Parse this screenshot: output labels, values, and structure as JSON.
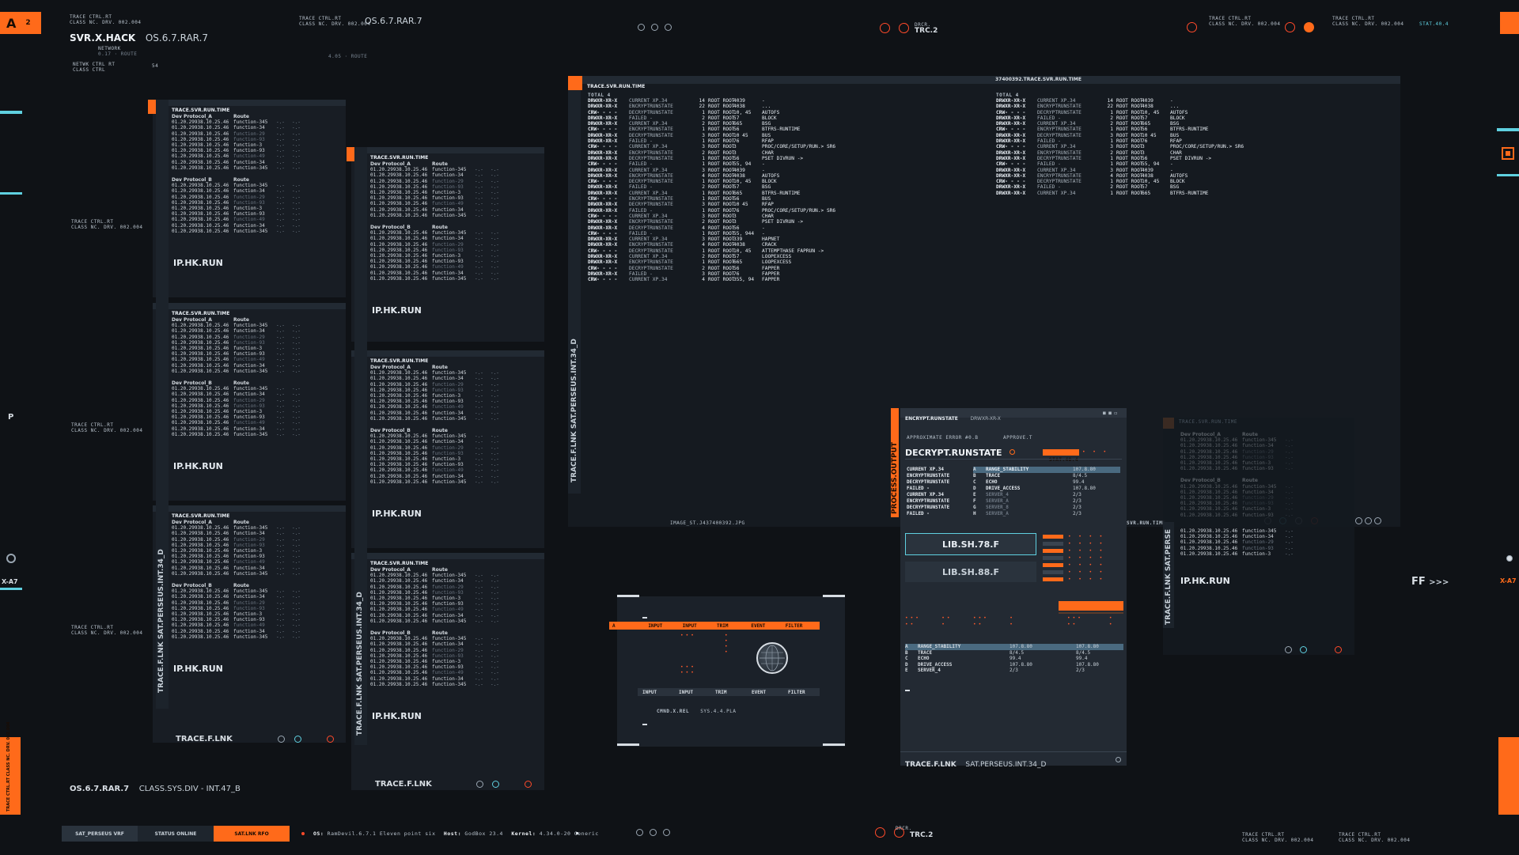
{
  "header": {
    "logo_letter": "A",
    "logo_num": "2",
    "app_small_1": "TRACE CTRL.RT",
    "app_small_2": "CLASS NC. DRV. 002.004",
    "title_bold": "SVR.X.HACK",
    "title_version": "OS.6.7.RAR.7",
    "network_label": "NETWORK",
    "network_sub": "0.17 · ROUTE",
    "netctrl_1": "NETWK CTRL RT",
    "netctrl_2": "CLASS CTRL",
    "netctrl_val": "54",
    "mid_small_1": "TRACE CTRL.RT",
    "mid_small_2": "CLASS NC. DRV. 002.004",
    "mid_version": "OS.6.7.RAR.7",
    "mid_route": "4.05 · ROUTE",
    "trc_small": "DRCR.",
    "trc_label": "TRC.2",
    "right_small_1": "TRACE CTRL.RT",
    "right_small_2": "CLASS NC. DRV. 002.004",
    "right_small_3": "TRACE CTRL.RT",
    "right_small_4": "CLASS NC. DRV. 002.004",
    "right_tag": "STAT.40.4"
  },
  "left_side": {
    "label_a": "TRACE CTRL.RT",
    "label_b": "CLASS NC. DRV. 002.004",
    "p_label": "P",
    "xa7": "X-A7",
    "bottom_vertical": "TRACE CTRL.RT CLASS NC. DRV. 002.004"
  },
  "route_panel": {
    "header": "TRACE.SVR.RUN.TIME",
    "col_a": "Dev Protocol_A",
    "col_b": "Dev Protocol_B",
    "col_route": "Route",
    "rows": [
      {
        "t": "01.20.29938.10.25.46",
        "f": "function-345",
        "dim": false
      },
      {
        "t": "01.20.29938.10.25.46",
        "f": "function-34",
        "dim": false
      },
      {
        "t": "01.20.29938.10.25.46",
        "f": "function-29",
        "dim": true
      },
      {
        "t": "01.20.29938.10.25.46",
        "f": "function-93",
        "dim": true
      },
      {
        "t": "01.20.29938.10.25.46",
        "f": "function-3",
        "dim": false
      },
      {
        "t": "01.20.29938.10.25.46",
        "f": "function-93",
        "dim": false
      },
      {
        "t": "01.20.29938.10.25.46",
        "f": "function-49",
        "dim": true
      },
      {
        "t": "01.20.29938.10.25.46",
        "f": "function-34",
        "dim": false
      },
      {
        "t": "01.20.29938.10.25.46",
        "f": "function-345",
        "dim": false
      }
    ],
    "run_label": "IP.HK.RUN"
  },
  "vertical_labels": {
    "col1": "TRACE.F.LNK  SAT.PERSEUS.INT.34_D",
    "col2": "TRACE.F.LNK  SAT.PERSEUS.INT.34_D",
    "big": "TRACE.F.LNK  SAT.PERSEUS.INT.34_D",
    "process": "PROCESS.OUTPUT",
    "right": "TRACE.F.LNK  SAT.PERSE"
  },
  "bottom": {
    "trace_lnk": "TRACE.F.LNK",
    "os_label": "OS.6.7.RAR.7",
    "class_sys": "CLASS.SYS.DIV - INT.47_B",
    "tab_1": "SAT_PERSEUS VRF",
    "tab_2": "STATUS ONLINE",
    "tab_3": "SAT.LNK RFO",
    "os_key": "OS:",
    "os_val": "RamDevil.6.7.1 Eleven point six",
    "host_key": "Host:",
    "host_val": "GodBox 23.4",
    "kernel_key": "Kernel:",
    "kernel_val": "4.34.0-20 Generic",
    "trc_small": "DRCR.",
    "trc_label": "TRC.2",
    "right_small_1": "TRACE CTRL.RT",
    "right_small_2": "CLASS NC. DRV. 002.004",
    "right_small_3": "TRACE CTRL.RT",
    "right_small_4": "CLASS NC. DRV. 002.004"
  },
  "trace_panel": {
    "header_left": "TRACE.SVR.RUN.TIME",
    "header_right": "37400392.TRACE.SVR.RUN.TIME",
    "total_label": "TOTAL 4",
    "rows": [
      [
        "DRWXR-XR-X",
        "CURRENT XP.34",
        "14",
        "ROOT ROOT",
        "4039",
        "-"
      ],
      [
        "DRWXR-XR-X",
        "ENCRYPTRUNSTATE",
        "22",
        "ROOT ROOT",
        "4038",
        "..."
      ],
      [
        "CRW- - - -",
        "DECRYPTRUNSTATE",
        "1",
        "ROOT ROOT",
        "10, 45",
        "AUTOFS"
      ],
      [
        "DRWXR-XR-X",
        "FAILED -",
        "2",
        "ROOT ROOT",
        "57",
        "BLOCK"
      ],
      [
        "DRWXR-XR-X",
        "CURRENT XP.34",
        "2",
        "ROOT ROOT",
        "665",
        "BSG"
      ],
      [
        "CRW- - - -",
        "ENCRYPTRUNSTATE",
        "1",
        "ROOT ROOT",
        "56",
        "BTFRS-RUNTIME"
      ],
      [
        "DRWXR-XR-X",
        "DECRYPTRUNSTATE",
        "3",
        "ROOT ROOT",
        "10 45",
        "BUS"
      ],
      [
        "DRWXR-XR-X",
        "FAILED -",
        "1",
        "ROOT ROOT",
        "76",
        "RFAP"
      ],
      [
        "CRW- - - -",
        "CURRENT XP.34",
        "3",
        "ROOT ROOT",
        "3",
        "PROC/CORE/SETUP/RUN.> SR6"
      ],
      [
        "DRWXR-XR-X",
        "ENCRYPTRUNSTATE",
        "2",
        "ROOT ROOT",
        "3",
        "CHAR"
      ],
      [
        "DRWXR-XR-X",
        "DECRYPTRUNSTATE",
        "1",
        "ROOT ROOT",
        "56",
        "PSET DIVRUN ->"
      ],
      [
        "CRW- - - -",
        "FAILED -",
        "1",
        "ROOT ROOT",
        "55, 94",
        "-"
      ],
      [
        "DRWXR-XR-X",
        "CURRENT XP.34",
        "3",
        "ROOT ROOT",
        "4039",
        "-"
      ],
      [
        "DRWXR-XR-X",
        "ENCRYPTRUNSTATE",
        "4",
        "ROOT ROOT",
        "4038",
        "AUTOFS"
      ],
      [
        "CRW- - - -",
        "DECRYPTRUNSTATE",
        "1",
        "ROOT ROOT",
        "10, 45",
        "BLOCK"
      ],
      [
        "DRWXR-XR-X",
        "FAILED -",
        "2",
        "ROOT ROOT",
        "57",
        "BSG"
      ],
      [
        "DRWXR-XR-X",
        "CURRENT XP.34",
        "1",
        "ROOT ROOT",
        "665",
        "BTFRS-RUNTIME"
      ]
    ],
    "rows_extra": [
      [
        "CRW- - - -",
        "ENCRYPTRUNSTATE",
        "1",
        "ROOT ROOT",
        "56",
        "BUS"
      ],
      [
        "DRWXR-XR-X",
        "DECRYPTRUNSTATE",
        "3",
        "ROOT ROOT",
        "10 45",
        "RFAP"
      ],
      [
        "DRWXR-XR-X",
        "FAILED -",
        "1",
        "ROOT ROOT",
        "76",
        "PROC/CORE/SETUP/RUN.> SR6"
      ],
      [
        "CRW- - - -",
        "CURRENT XP.34",
        "3",
        "ROOT ROOT",
        "3",
        "CHAR"
      ],
      [
        "DRWXR-XR-X",
        "ENCRYPTRUNSTATE",
        "2",
        "ROOT ROOT",
        "3",
        "PSET DIVRUN ->"
      ],
      [
        "DRWXR-XR-X",
        "DECRYPTRUNSTATE",
        "4",
        "ROOT ROOT",
        "56",
        "-"
      ],
      [
        "CRW- - - -",
        "FAILED -",
        "1",
        "ROOT ROOT",
        "55, 944",
        "-"
      ],
      [
        "DRWXR-XR-X",
        "CURRENT XP.34",
        "3",
        "ROOT ROOT",
        "339",
        "HAPNET"
      ],
      [
        "DRWXR-XR-X",
        "ENCRYPTRUNSTATE",
        "4",
        "ROOT ROOT",
        "4038",
        "CRACK"
      ],
      [
        "CRW- - - -",
        "DECRYPTRUNSTATE",
        "1",
        "ROOT ROOT",
        "10, 45",
        "ATTEMPTHASE FAPRUN ->"
      ],
      [
        "DRWXR-XR-X",
        "CURRENT XP.34",
        "2",
        "ROOT ROOT",
        "57",
        "LOOPEXCESS"
      ],
      [
        "DRWXR-XR-X",
        "ENCRYPTRUNSTATE",
        "1",
        "ROOT ROOT",
        "665",
        "LOOPEXCESS"
      ],
      [
        "CRW- - - -",
        "DECRYPTRUNSTATE",
        "2",
        "ROOT ROOT",
        "56",
        "FAPPER"
      ],
      [
        "DRWXR-XR-X",
        "FAILED -",
        "3",
        "ROOT ROOT",
        "76",
        "FAPPER"
      ],
      [
        "CRW- - - -",
        "CURRENT XP.34",
        "4",
        "ROOT ROOT",
        "355, 94",
        "FAPPER"
      ]
    ],
    "image_label": "IMAGE_ST.J437400392.JPG",
    "svr_runtime": "SVR.RUN.TIME"
  },
  "cmd_panel": {
    "tabs": [
      "A",
      "INPUT",
      "INPUT",
      "TRIM",
      "EVENT",
      "FILTER"
    ],
    "tabs_bottom": [
      "INPUT",
      "INPUT",
      "TRIM",
      "EVENT",
      "FILTER"
    ],
    "cmd_label": "CMND.X.REL",
    "cmd_val": "SYS.4.4.PLA"
  },
  "decrypt_panel": {
    "header_a": "ENCRYPT.RUNSTATE",
    "header_b": "DRWXR-XR-X",
    "sub_a": "APPROXIMATE ERROR #0.B",
    "sub_b": "APPROVE.T",
    "title": "DECRYPT.RUNSTATE",
    "status_tag": "STAT.40.4",
    "left_rows": [
      "CURRENT XP.34",
      "ENCRYPTRUNSTATE",
      "DECRYPTRUNSTATE",
      "FAILED -",
      "CURRENT XP.34",
      "ENCRYPTRUNSTATE",
      "DECRYPTRUNSTATE",
      "FAILED -"
    ],
    "table": [
      {
        "k": "A",
        "name": "RANGE_STABILITY",
        "v": "107.8.80"
      },
      {
        "k": "B",
        "name": "TRACE",
        "v": "8/4.5"
      },
      {
        "k": "C",
        "name": "ECHO",
        "v": "99.4"
      },
      {
        "k": "D",
        "name": "DRIVE_ACCESS",
        "v": "107.8.80"
      },
      {
        "k": "E",
        "name": "SERVER_4",
        "v": "2/3"
      },
      {
        "k": "F",
        "name": "SERVER_A",
        "v": "2/3"
      },
      {
        "k": "G",
        "name": "SERVER_8",
        "v": "2/3"
      },
      {
        "k": "H",
        "name": "SERVER_A",
        "v": "2/3"
      }
    ],
    "btn_1": "LIB.SH.78.F",
    "btn_2": "LIB.SH.88.F",
    "bottom_table": [
      {
        "k": "A",
        "name": "RANGE_STABILITY",
        "v1": "107.8.80",
        "v2": "107.8.80"
      },
      {
        "k": "B",
        "name": "TRACE",
        "v1": "8/4.5",
        "v2": "8/4.5"
      },
      {
        "k": "C",
        "name": "ECHO",
        "v1": "99.4",
        "v2": "99.4"
      },
      {
        "k": "D",
        "name": "DRIVE_ACCESS",
        "v1": "107.8.80",
        "v2": "107.8.80"
      },
      {
        "k": "E",
        "name": "SERVER_4",
        "v1": "2/3",
        "v2": "2/3"
      }
    ],
    "footer_a": "TRACE.F.LNK",
    "footer_b": "SAT.PERSEUS.INT.34_D"
  },
  "right_panel": {
    "header": "TRACE.SVR.RUN.TIME",
    "run_label": "IP.HK.RUN",
    "ff": "FF",
    "ff_arrows": ">>>",
    "xa7": "X-A7"
  },
  "colors": {
    "accent": "#ff6a1a",
    "cyan": "#5fd0e0",
    "bg": "#0f1216",
    "panel": "#181d24"
  }
}
